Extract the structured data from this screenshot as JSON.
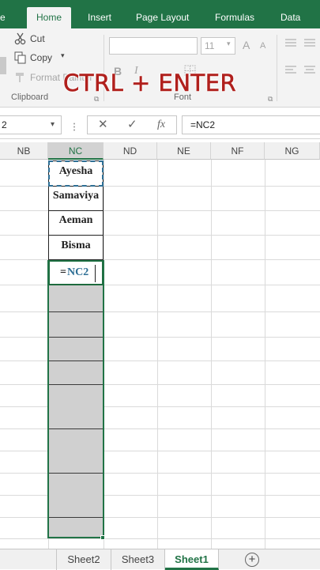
{
  "ribbon_tabs": [
    "e",
    "Home",
    "Insert",
    "Page Layout",
    "Formulas",
    "Data"
  ],
  "clipboard": {
    "cut_label": "Cut",
    "copy_label": "Copy",
    "format_label": "Format Painter",
    "group_label": "Clipboard"
  },
  "font_group": {
    "font_size": "11",
    "bold": "B",
    "italic": "I",
    "grow": "A",
    "shrink": "A",
    "group_label": "Font"
  },
  "overlay_caption": "CTRL + ENTER",
  "formula_bar": {
    "name_box": "2",
    "cancel_glyph": "✕",
    "enter_glyph": "✓",
    "fx_glyph": "fx",
    "formula": "=NC2"
  },
  "columns": [
    "NB",
    "NC",
    "ND",
    "NE",
    "NF",
    "NG"
  ],
  "selected_column": "NC",
  "cells": {
    "nc2": "Ayesha",
    "nc3": "Samaviya",
    "nc4": "Aeman",
    "nc5": "Bisma",
    "nc6_prefix": "=",
    "nc6_ref": "NC2"
  },
  "sheet_tabs": [
    "Sheet2",
    "Sheet3",
    "Sheet1"
  ],
  "active_sheet": "Sheet1",
  "add_sheet_glyph": "+",
  "colors": {
    "excel_green": "#217346",
    "caption_red": "#b0201d",
    "reference_blue": "#2e6f95"
  }
}
